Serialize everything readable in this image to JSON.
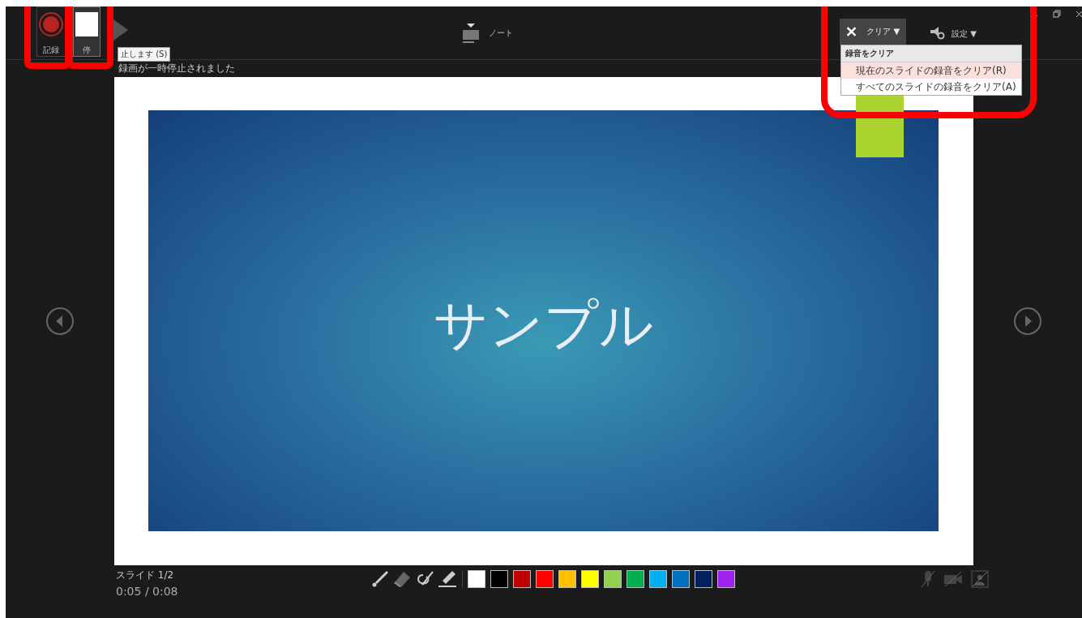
{
  "top_bar": {
    "record_button": {
      "label": "記録"
    },
    "stop_button": {
      "label": "停"
    },
    "tooltip": "止します (S)",
    "notes_button": {
      "label": "ノート"
    },
    "clear_button": {
      "label": "クリア ▼"
    },
    "settings_button": {
      "label": "設定 ▼"
    }
  },
  "clear_menu": {
    "header": "録音をクリア",
    "items": [
      {
        "label": "現在のスライドの録音をクリア(R)",
        "selected": true
      },
      {
        "label": "すべてのスライドの録音をクリア(A)",
        "selected": false
      }
    ]
  },
  "status_message": "録画が一時停止されました",
  "slide": {
    "title": "サンプル"
  },
  "slide_counter": "スライド 1/2",
  "timer": "0:05 / 0:08",
  "ink_colors": [
    {
      "color": "#ffffff"
    },
    {
      "color": "#000000"
    },
    {
      "color": "#c00000"
    },
    {
      "color": "#ff0000"
    },
    {
      "color": "#ffc000"
    },
    {
      "color": "#ffff00"
    },
    {
      "color": "#92d050"
    },
    {
      "color": "#00b050"
    },
    {
      "color": "#00b0f0"
    },
    {
      "color": "#0070c0"
    },
    {
      "color": "#002060"
    },
    {
      "color": "#a020f0"
    }
  ]
}
